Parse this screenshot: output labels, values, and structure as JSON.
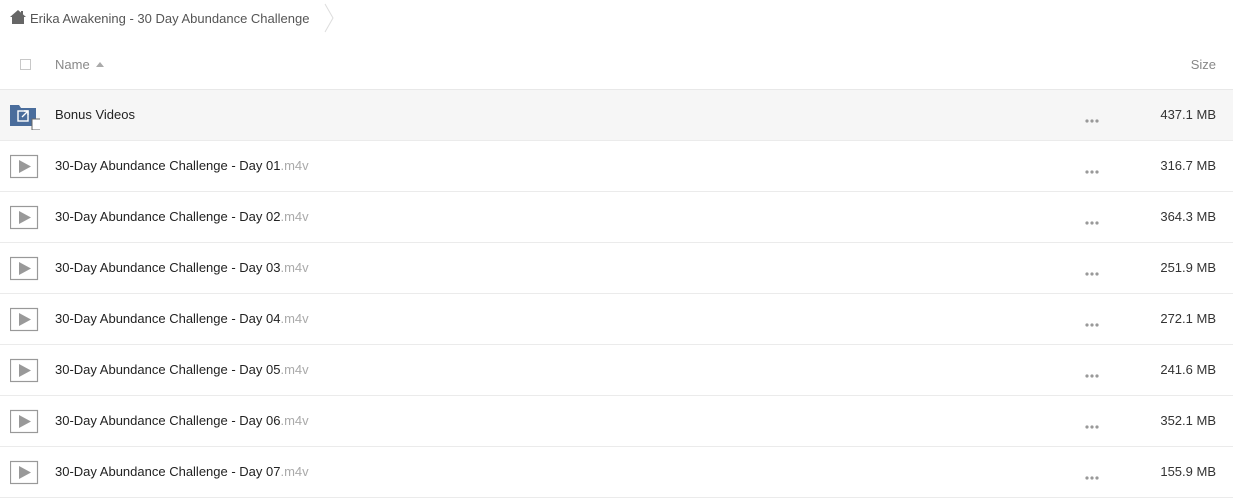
{
  "breadcrumb": {
    "path": "Erika Awakening - 30 Day Abundance Challenge"
  },
  "table": {
    "columns": {
      "name": "Name",
      "size": "Size"
    },
    "sort": "name-ascending",
    "rows": [
      {
        "type": "folder",
        "name": "Bonus Videos",
        "ext": "",
        "size": "437.1 MB"
      },
      {
        "type": "video",
        "name": "30-Day Abundance Challenge - Day 01",
        "ext": ".m4v",
        "size": "316.7 MB"
      },
      {
        "type": "video",
        "name": "30-Day Abundance Challenge - Day 02",
        "ext": ".m4v",
        "size": "364.3 MB"
      },
      {
        "type": "video",
        "name": "30-Day Abundance Challenge - Day 03",
        "ext": ".m4v",
        "size": "251.9 MB"
      },
      {
        "type": "video",
        "name": "30-Day Abundance Challenge - Day 04",
        "ext": ".m4v",
        "size": "272.1 MB"
      },
      {
        "type": "video",
        "name": "30-Day Abundance Challenge - Day 05",
        "ext": ".m4v",
        "size": "241.6 MB"
      },
      {
        "type": "video",
        "name": "30-Day Abundance Challenge - Day 06",
        "ext": ".m4v",
        "size": "352.1 MB"
      },
      {
        "type": "video",
        "name": "30-Day Abundance Challenge - Day 07",
        "ext": ".m4v",
        "size": "155.9 MB"
      }
    ]
  },
  "colors": {
    "folder": "#4a6d9c",
    "hover_row": "#f6f6f6",
    "extension_text": "#aaaaaa"
  }
}
